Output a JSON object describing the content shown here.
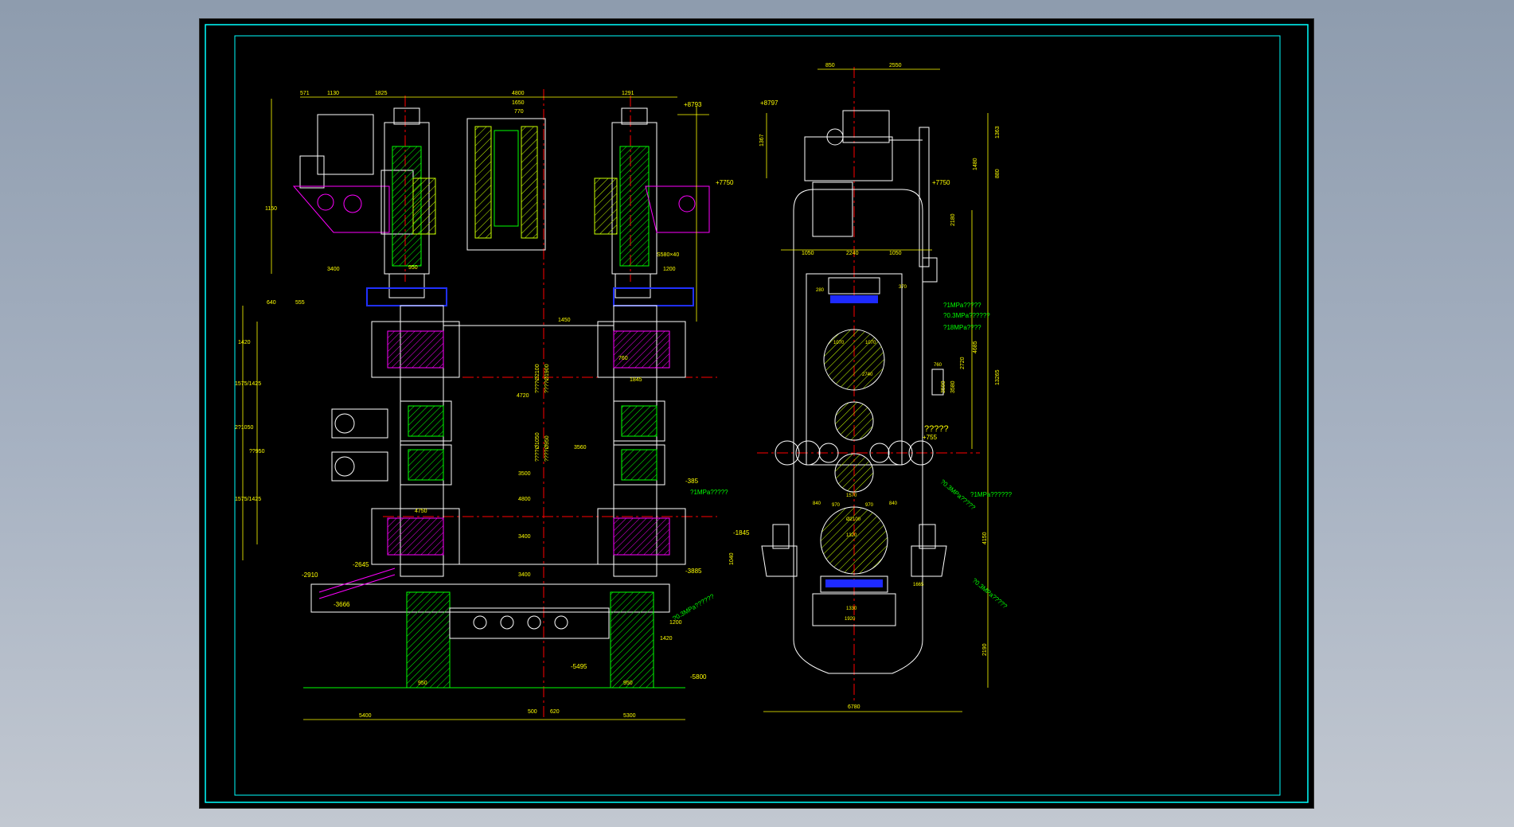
{
  "drawing": {
    "colors": {
      "background": "#000000",
      "frame": "#00ffff",
      "dimension": "#ffff00",
      "part": "#ffffff",
      "hatch": "#00ff00",
      "centerline": "#ff0000",
      "blue": "#2030ff",
      "magenta": "#ff00ff",
      "cyan": "#00ffff"
    },
    "front_view": {
      "top_dims": [
        "571",
        "1130",
        "1825",
        "4800",
        "1650",
        "770",
        "1291"
      ],
      "left_dims": [
        "1150",
        "640",
        "555",
        "1420",
        "1575/1425",
        "2?1050",
        "??950",
        "1575/1425"
      ],
      "mid_dims": [
        "3400",
        "950",
        "4720",
        "3560",
        "3500",
        "4800",
        "4750",
        "3400",
        "1200",
        "1450",
        "1845",
        "760",
        "1200",
        "3400"
      ],
      "rolls": [
        "????Ø2100",
        "????Ø1900",
        "????Ø1050",
        "????Ø950"
      ],
      "bolt_label": "S580×40",
      "bottom_dims": [
        "5400",
        "500",
        "620",
        "5300",
        "950",
        "950",
        "1420"
      ],
      "elevations": [
        "+8793",
        "+7750",
        "-385",
        "-2645",
        "-2910",
        "-3666",
        "-5495",
        "-5800"
      ]
    },
    "side_view": {
      "top_dims": [
        "850",
        "2550"
      ],
      "elevation_top": "+8797",
      "elevation_mid": "+7750",
      "elevation_low": "+755",
      "elevation_left_1": "-1845",
      "elevation_left_2": "-3885",
      "width_dims": [
        "1050",
        "2240",
        "1050"
      ],
      "right_dims": [
        "1363",
        "1480",
        "880",
        "2180",
        "4685",
        "2720",
        "3580",
        "3590",
        "13265",
        "4150",
        "2190"
      ],
      "left_dims": [
        "1367",
        "1040"
      ],
      "inner_dims": [
        "280",
        "370",
        "1070",
        "1070",
        "2740",
        "760",
        "840",
        "1570",
        "970",
        "970",
        "840",
        "Ø2100",
        "1320",
        "1330",
        "1665",
        "1920"
      ],
      "question": "?????",
      "pressure_labels": [
        "?1MPa?????",
        "?0.3MPa??????",
        "?18MPa????",
        "?1MPa?????",
        "?0.3MPa??????",
        "?1MPa??????",
        "?0.3MPa?????",
        "?0.3MPa?????"
      ],
      "bottom_dim": "6780"
    }
  }
}
